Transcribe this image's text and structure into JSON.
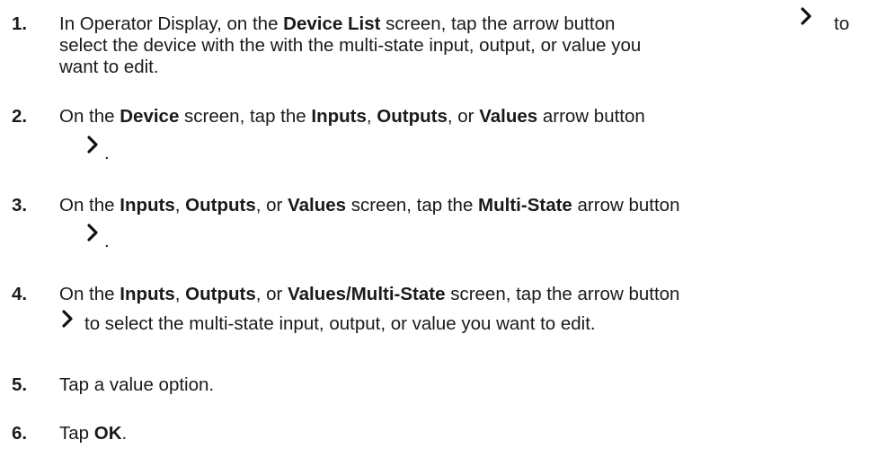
{
  "steps": [
    {
      "number": "1.",
      "lines": [
        [
          "In Operator Display, on the ",
          {
            "b": "Device List"
          },
          " screen, tap the arrow button"
        ],
        [
          "select the device with the with the multi-state input, output, or value you"
        ],
        [
          "want to edit."
        ]
      ],
      "after_icon": "to"
    },
    {
      "number": "2.",
      "lines": [
        [
          "On the ",
          {
            "b": "Device"
          },
          " screen, tap the ",
          {
            "b": "Inputs"
          },
          ", ",
          {
            "b": "Outputs"
          },
          ", or ",
          {
            "b": "Values"
          },
          " arrow button"
        ]
      ],
      "after_icon": "."
    },
    {
      "number": "3.",
      "lines": [
        [
          "On the ",
          {
            "b": "Inputs"
          },
          ", ",
          {
            "b": "Outputs"
          },
          ", or ",
          {
            "b": "Values"
          },
          " screen, tap the ",
          {
            "b": "Multi-State"
          },
          " arrow button"
        ]
      ],
      "after_icon": "."
    },
    {
      "number": "4.",
      "lines": [
        [
          "On the ",
          {
            "b": "Inputs"
          },
          ", ",
          {
            "b": "Outputs"
          },
          ", or ",
          {
            "b": "Values/Multi-State"
          },
          " screen, tap the arrow button"
        ]
      ],
      "after_icon": "to select the multi-state input, output, or value you want to edit."
    },
    {
      "number": "5.",
      "lines": [
        [
          "Tap a value option."
        ]
      ]
    },
    {
      "number": "6.",
      "lines": [
        [
          "Tap ",
          {
            "b": "OK"
          },
          "."
        ]
      ]
    }
  ],
  "icons": {
    "arrow_button": "chevron-right-icon"
  }
}
